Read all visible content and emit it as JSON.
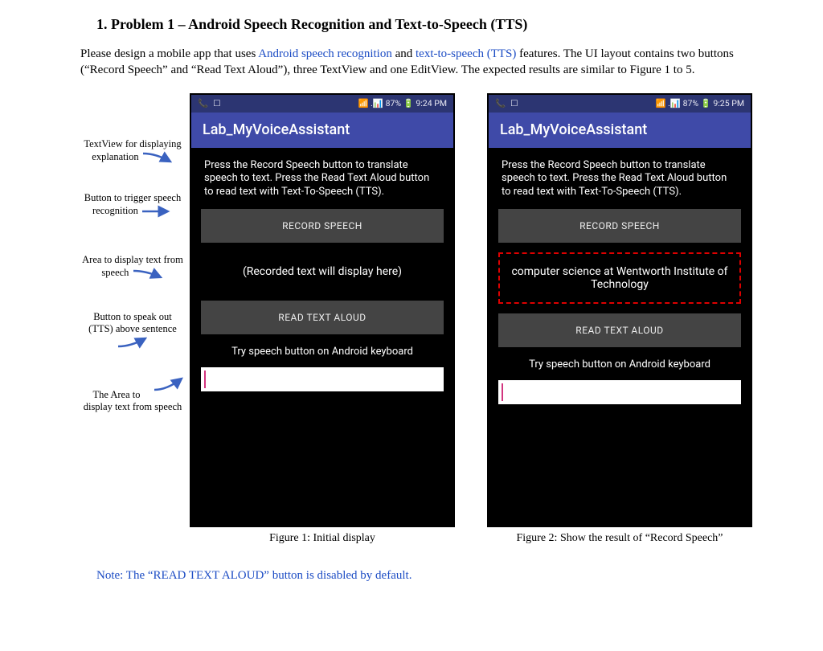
{
  "heading": "1.  Problem 1 – Android Speech Recognition and Text-to-Speech (TTS)",
  "intro": {
    "prefix": "Please design a mobile app that uses ",
    "link1": "Android speech recognition",
    "mid1": " and ",
    "link2": "text-to-speech (TTS)",
    "suffix": " features. The UI layout contains two buttons (“Record Speech” and “Read Text Aloud”), three TextView and one EditView. The expected results are similar to Figure 1 to 5."
  },
  "labels": [
    "TextView for displaying explanation",
    "Button to trigger speech recognition",
    "Area to display text from speech",
    "Button to speak out (TTS) above sentence",
    "The Area to display text from speech"
  ],
  "phones": [
    {
      "status_left_icons": [
        "📞",
        "☐"
      ],
      "status_right": "📶 .📊 87% 🔋 9:24 PM",
      "app_title": "Lab_MyVoiceAssistant",
      "explain": "Press the Record Speech button to translate speech to text. Press the Read Text Aloud button to read text with Text-To-Speech (TTS).",
      "btn1": "RECORD SPEECH",
      "mid": "(Recorded text will display here)",
      "mid_highlight": false,
      "btn2": "READ TEXT ALOUD",
      "try": "Try speech button on Android keyboard",
      "caption": "Figure 1: Initial display"
    },
    {
      "status_left_icons": [
        "📞",
        "☐"
      ],
      "status_right": "📶 .📊 87% 🔋 9:25 PM",
      "app_title": "Lab_MyVoiceAssistant",
      "explain": "Press the Record Speech button to translate speech to text. Press the Read Text Aloud button to read text with Text-To-Speech (TTS).",
      "btn1": "RECORD SPEECH",
      "mid": "computer science at Wentworth Institute of Technology",
      "mid_highlight": true,
      "btn2": "READ TEXT ALOUD",
      "try": "Try speech button on Android keyboard",
      "caption": "Figure 2: Show the result of “Record Speech”"
    }
  ],
  "note": "Note: The “READ TEXT ALOUD” button is disabled by default."
}
